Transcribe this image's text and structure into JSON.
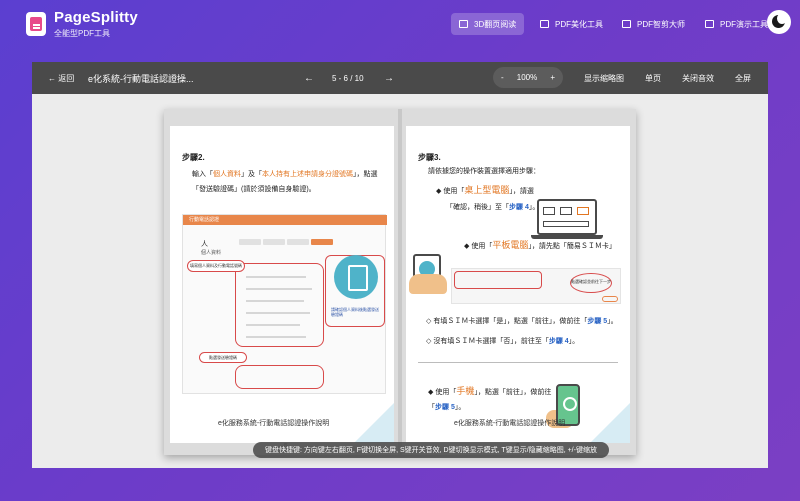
{
  "app": {
    "brand": "PageSplitty",
    "subtitle": "全能型PDF工具"
  },
  "nav": {
    "items": [
      {
        "label": "3D翻页阅读",
        "active": true,
        "icon": "book-icon"
      },
      {
        "label": "PDF美化工具",
        "active": false,
        "icon": "document-icon"
      },
      {
        "label": "PDF智剪大师",
        "active": false,
        "icon": "image-icon"
      },
      {
        "label": "PDF演示工具",
        "active": false,
        "icon": "presentation-icon"
      }
    ],
    "theme_toggle_icon": "moon-icon"
  },
  "toolbar": {
    "back_label": "← 返回",
    "doc_title": "e化系統-行動電話認證操...",
    "prev_label": "←",
    "page_indicator": "5 - 6 / 10",
    "next_label": "→",
    "zoom_out": "-",
    "zoom_level": "100%",
    "zoom_in": "+",
    "thumbnails_label": "显示缩略图",
    "single_page_label": "单页",
    "mute_label": "关闭音效",
    "fullscreen_label": "全屏"
  },
  "left_page": {
    "step_title": "步驟2.",
    "line1_prefix": "輸入「",
    "line1_orange1": "個人資料",
    "line1_mid": "」及「",
    "line1_orange2": "本人持有上述申請身分證號碼",
    "line1_suffix": "」，點選",
    "line2": "「發送驗證碼」(請於須設備自身驗證)。",
    "shot_header": "行動電話認證",
    "shot_avatar": "人",
    "shot_label": "個人資料",
    "bubble1": "填寫個人資料及行動電話號碼",
    "bubble2": "點選發送驗證碼",
    "shot_hint": "請確認個人資料後點選發送驗證碼",
    "caption": "e化服務系統-行動電話認證操作說明",
    "page_number": "5"
  },
  "right_page": {
    "step_title": "步驟3.",
    "intro": "請依據您的操作裝置選擇適用步驟：",
    "pc_prefix": "◆ 使用「",
    "pc_orange": "桌上型電腦",
    "pc_suffix": "」，請選",
    "pc_line2_prefix": "「確認，稍後」至「",
    "pc_step": "步驟 4",
    "pc_line2_suffix": "」。",
    "tablet_prefix": "◆ 使用「",
    "tablet_orange": "平板電腦",
    "tablet_suffix": "」，請先點「簡易ＳＩＭ卡」",
    "rshot_bubble": "點選確認並前往下一步",
    "sim_yes_prefix": "◇ 有填ＳＩＭ卡選擇「是」，點選「前往」，做前往「",
    "sim_yes_step": "步驟 5",
    "sim_yes_suffix": "」。",
    "sim_no_prefix": "◇ 沒有填ＳＩＭ卡選擇「否」，前往至「",
    "sim_no_step": "步驟 4",
    "sim_no_suffix": "」。",
    "phone_prefix": "◆ 使用「",
    "phone_orange": "手機",
    "phone_suffix": "」，點選「前往」，做前往",
    "phone_line2_prefix": "「",
    "phone_step": "步驟 5",
    "phone_line2_suffix": "」。",
    "caption": "e化服務系統-行動電話認證操作說明",
    "page_number": "6"
  },
  "hint_bar": "键盘快捷键: 方向键左右翻页, F键切换全屏, S键开关音效, D键切换显示模式, T键显示/隐藏缩略图, +/-键缩放",
  "colors": {
    "accent_orange": "#e27622",
    "step_blue": "#2a64c5",
    "header_gradient_start": "#5b3fd0",
    "toolbar": "#4a4a4a"
  }
}
